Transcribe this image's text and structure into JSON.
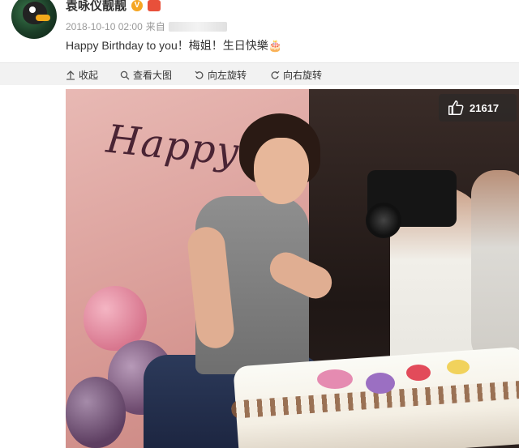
{
  "post": {
    "username": "袁咏仪靓靓",
    "verified_badge": "V",
    "timestamp": "2018-10-10 02:00",
    "source_prefix": "来自",
    "text": "Happy Birthday to you！梅姐！生日快樂🎂"
  },
  "toolbar": {
    "collapse": "收起",
    "view_large": "查看大图",
    "rotate_left": "向左旋转",
    "rotate_right": "向右旋转"
  },
  "photo": {
    "wall_text": "Happy",
    "like_count": "21617",
    "icon": "thumbs-up-icon"
  },
  "colors": {
    "toolbar_bg": "#f2f2f2",
    "badge_orange": "#f5a623"
  }
}
